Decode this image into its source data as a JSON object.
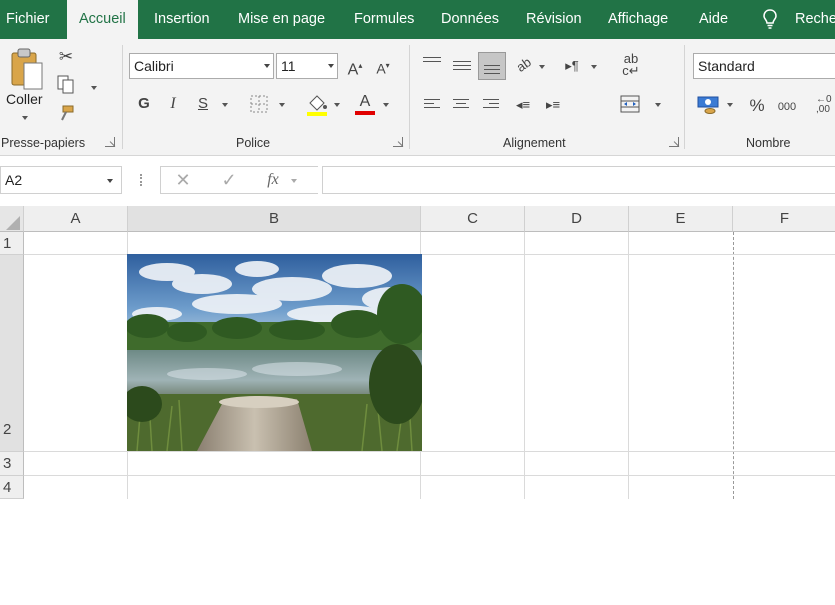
{
  "menu": {
    "tabs": [
      "Fichier",
      "Accueil",
      "Insertion",
      "Mise en page",
      "Formules",
      "Données",
      "Révision",
      "Affichage",
      "Aide"
    ],
    "search": "Reche"
  },
  "ribbon": {
    "clipboard": {
      "paste_label": "Coller",
      "group_label": "Presse-papiers"
    },
    "font": {
      "name": "Calibri",
      "size": "11",
      "bold": "G",
      "italic": "I",
      "underline": "S",
      "grow": "A",
      "shrink": "A",
      "font_color_letter": "A",
      "group_label": "Police",
      "fill_color": "#ffff00",
      "font_color": "#e00000"
    },
    "alignment": {
      "group_label": "Alignement",
      "orientation": "ab",
      "wrap": "c"
    },
    "number": {
      "format": "Standard",
      "percent": "%",
      "thousands": "000",
      "group_label": "Nombre"
    }
  },
  "formula_bar": {
    "name_box": "A2",
    "fx": "fx",
    "formula": ""
  },
  "grid": {
    "columns": [
      "A",
      "B",
      "C",
      "D",
      "E",
      "F"
    ],
    "rows": [
      "1",
      "2",
      "3",
      "4"
    ]
  },
  "colors": {
    "accent": "#217346"
  }
}
